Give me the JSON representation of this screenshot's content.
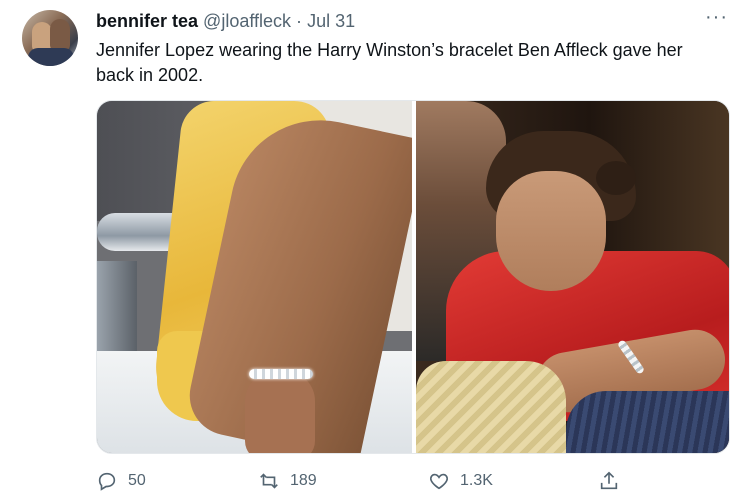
{
  "tweet": {
    "author_name": "bennifer tea",
    "author_handle": "@jloaffleck",
    "separator": "·",
    "date": "Jul 31",
    "text": "Jennifer Lopez wearing the Harry Winston’s bracelet Ben Affleck gave her back in 2002.",
    "more_label": "···"
  },
  "actions": {
    "reply_count": "50",
    "retweet_count": "189",
    "like_count": "1.3K"
  },
  "icons": {
    "reply": "reply-icon",
    "retweet": "retweet-icon",
    "like": "heart-icon",
    "share": "share-icon",
    "more": "more-icon"
  },
  "colors": {
    "text_primary": "#0f1419",
    "text_secondary": "#536471"
  }
}
